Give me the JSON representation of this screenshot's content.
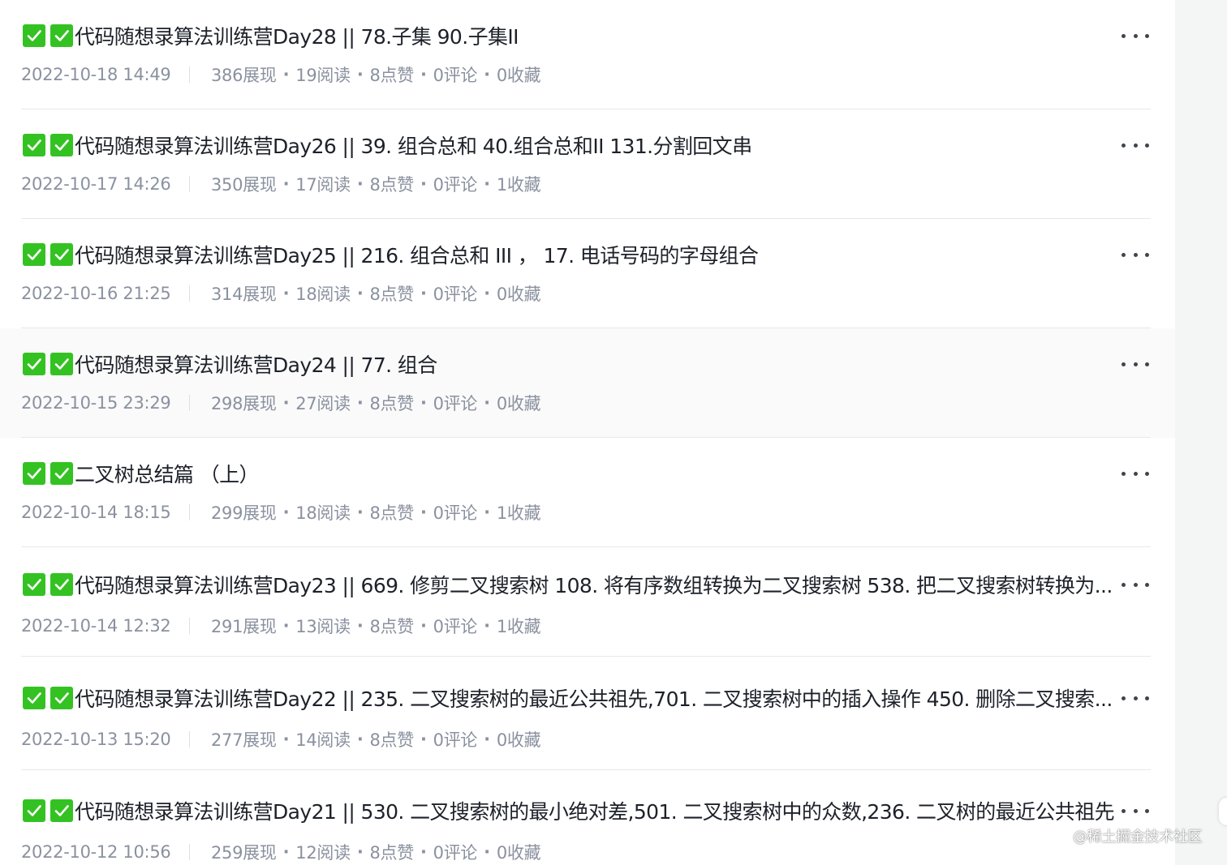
{
  "articles": [
    {
      "title": "代码随想录算法训练营Day28 || 78.子集 90.子集II",
      "date": "2022-10-18 14:49",
      "views": "386展现",
      "reads": "19阅读",
      "likes": "8点赞",
      "comments": "0评论",
      "favorites": "0收藏",
      "hovered": false
    },
    {
      "title": "代码随想录算法训练营Day26 || 39. 组合总和 40.组合总和II 131.分割回文串",
      "date": "2022-10-17 14:26",
      "views": "350展现",
      "reads": "17阅读",
      "likes": "8点赞",
      "comments": "0评论",
      "favorites": "1收藏",
      "hovered": false
    },
    {
      "title": "代码随想录算法训练营Day25 || 216. 组合总和 III ， 17. 电话号码的字母组合",
      "date": "2022-10-16 21:25",
      "views": "314展现",
      "reads": "18阅读",
      "likes": "8点赞",
      "comments": "0评论",
      "favorites": "0收藏",
      "hovered": false
    },
    {
      "title": "代码随想录算法训练营Day24 || 77. 组合",
      "date": "2022-10-15 23:29",
      "views": "298展现",
      "reads": "27阅读",
      "likes": "8点赞",
      "comments": "0评论",
      "favorites": "0收藏",
      "hovered": true
    },
    {
      "title": "二叉树总结篇 （上）",
      "date": "2022-10-14 18:15",
      "views": "299展现",
      "reads": "18阅读",
      "likes": "8点赞",
      "comments": "0评论",
      "favorites": "1收藏",
      "hovered": false
    },
    {
      "title": "代码随想录算法训练营Day23 || 669. 修剪二叉搜索树 108. 将有序数组转换为二叉搜索树 538. 把二叉搜索树转换为...",
      "date": "2022-10-14 12:32",
      "views": "291展现",
      "reads": "13阅读",
      "likes": "8点赞",
      "comments": "0评论",
      "favorites": "1收藏",
      "hovered": false
    },
    {
      "title": "代码随想录算法训练营Day22 || 235. 二叉搜索树的最近公共祖先,701. 二叉搜索树中的插入操作 450. 删除二叉搜索...",
      "date": "2022-10-13 15:20",
      "views": "277展现",
      "reads": "14阅读",
      "likes": "8点赞",
      "comments": "0评论",
      "favorites": "0收藏",
      "hovered": false
    },
    {
      "title": "代码随想录算法训练营Day21 || 530. 二叉搜索树的最小绝对差,501. 二叉搜索树中的众数,236. 二叉树的最近公共祖先",
      "date": "2022-10-12 10:56",
      "views": "259展现",
      "reads": "12阅读",
      "likes": "8点赞",
      "comments": "0评论",
      "favorites": "0收藏",
      "hovered": false
    }
  ],
  "separator": "·",
  "watermark": "@稀土掘金技术社区",
  "colors": {
    "check_green": "#34c223",
    "title_text": "#1d2129",
    "meta_text": "#8a919f",
    "divider": "#e8e8ea",
    "hover_bg": "#fafafa",
    "gutter_bg": "#f4f5f5"
  },
  "icons": {
    "check": "check-mark-button-icon",
    "more": "more-horizontal-icon"
  }
}
